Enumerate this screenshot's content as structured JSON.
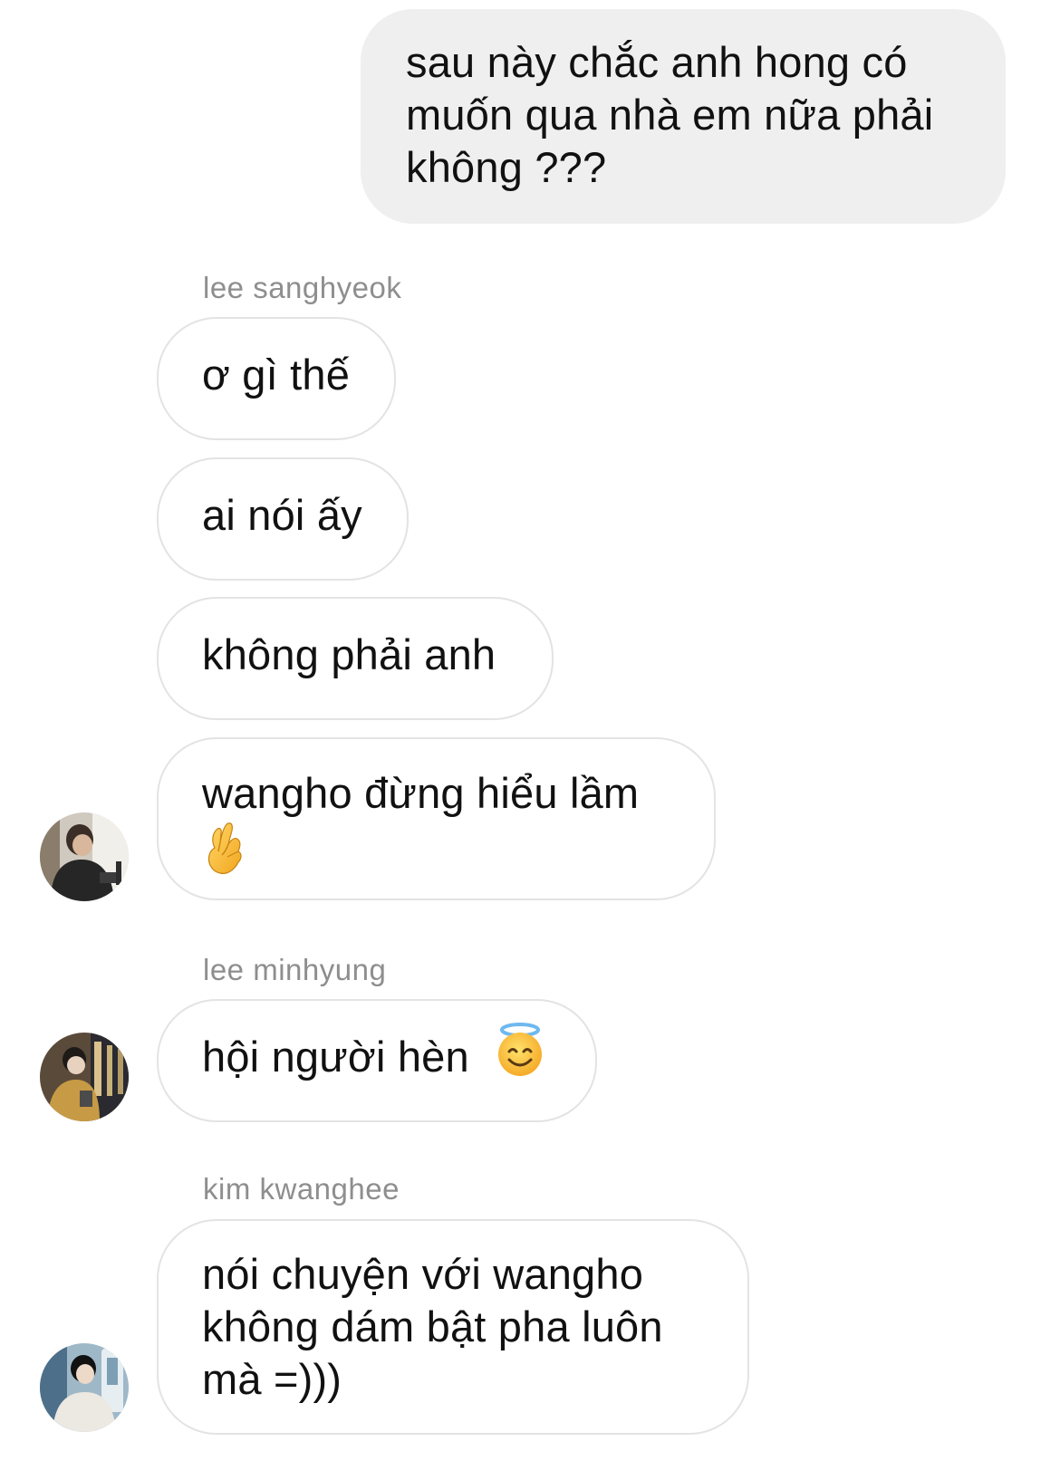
{
  "chat": {
    "sent_message": "sau này chắc anh hong có muốn qua nhà em nữa phải không ???",
    "groups": [
      {
        "sender": "lee sanghyeok",
        "messages": [
          "ơ gì thế",
          "ai nói ấy",
          "không phải anh",
          "wangho đừng hiểu lầm"
        ],
        "last_message_emoji": "crossed-fingers-emoji"
      },
      {
        "sender": "lee minhyung",
        "messages": [
          "hội người hèn"
        ],
        "last_message_emoji": "smiling-face-with-halo-emoji"
      },
      {
        "sender": "kim kwanghee",
        "messages": [
          "nói chuyện với wangho không dám bật pha luôn mà =)))"
        ]
      }
    ]
  },
  "colors": {
    "sent_bubble_bg": "#efefef",
    "received_bubble_border": "#e3e3e3",
    "sender_name_text": "#8e8e8e",
    "message_text": "#111111"
  }
}
